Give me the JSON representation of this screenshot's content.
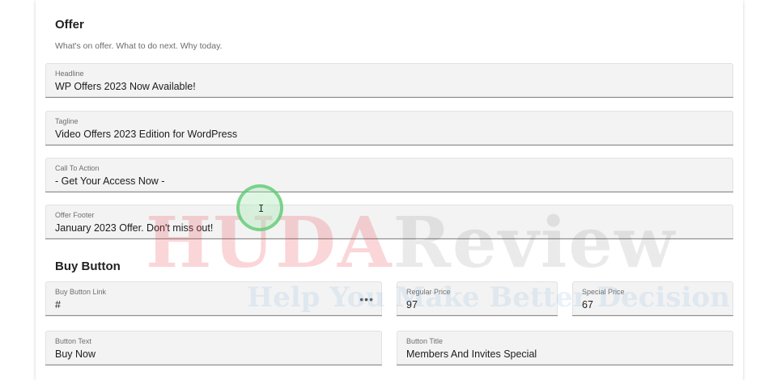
{
  "offer": {
    "title": "Offer",
    "subtitle": "What's on offer. What to do next. Why today.",
    "fields": {
      "headline": {
        "label": "Headline",
        "value": "WP Offers 2023 Now Available!"
      },
      "tagline": {
        "label": "Tagline",
        "value": "Video Offers 2023 Edition for WordPress"
      },
      "call_to_action": {
        "label": "Call To Action",
        "value": "- Get Your Access Now -"
      },
      "offer_footer": {
        "label": "Offer Footer",
        "value": "January 2023 Offer. Don't miss out!"
      }
    }
  },
  "buy_button": {
    "title": "Buy Button",
    "fields": {
      "link": {
        "label": "Buy Button Link",
        "value": "#",
        "menu_glyph": "•••"
      },
      "regular_price": {
        "label": "Regular Price",
        "value": "97"
      },
      "special_price": {
        "label": "Special Price",
        "value": "67"
      },
      "button_text": {
        "label": "Button Text",
        "value": "Buy Now"
      },
      "button_title": {
        "label": "Button Title",
        "value": "Members And Invites Special"
      }
    }
  },
  "watermark": {
    "brand_part1": "HUDA",
    "brand_part2": "Review",
    "tagline": "Help You Make Better Decision"
  },
  "cursor": {
    "glyph": "I",
    "icon": "text-cursor-icon"
  }
}
